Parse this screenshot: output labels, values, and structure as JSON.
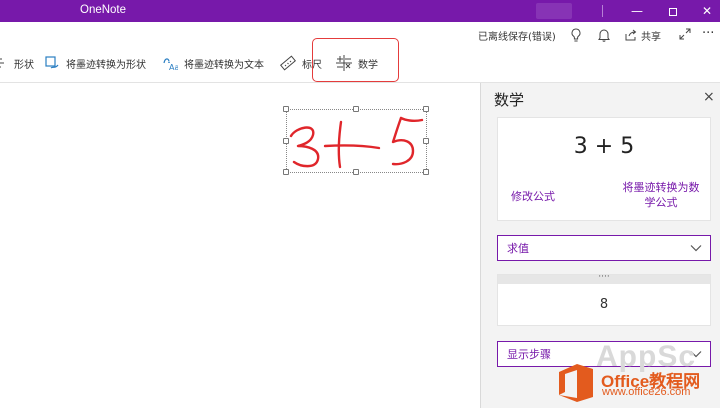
{
  "window": {
    "title": "OneNote",
    "minimize": "—",
    "close": "✕"
  },
  "status": {
    "saved_text": "已离线保存(错误)",
    "share_label": "共享",
    "more": "···"
  },
  "toolbar": {
    "shape_label": "形状",
    "ink_to_shape_label": "将墨迹转换为形状",
    "ink_to_text_label": "将墨迹转换为文本",
    "ruler_label": "标尺",
    "math_label": "数学"
  },
  "math_pane": {
    "title": "数学",
    "close": "×",
    "formula": "3 + 5",
    "edit_formula": "修改公式",
    "convert_ink_line1": "将墨迹转换为数",
    "convert_ink_line2": "学公式",
    "solve_option": "求值",
    "result_grip": "····",
    "result": "8",
    "steps_option": "显示步骤"
  },
  "ink": {
    "content": "3+5",
    "color": "#e0262b"
  },
  "colors": {
    "accent": "#7719aa",
    "highlight": "#e43c3c"
  },
  "watermark": {
    "brand": "AppSc",
    "title": "Office教程网",
    "url": "www.office26.com"
  }
}
